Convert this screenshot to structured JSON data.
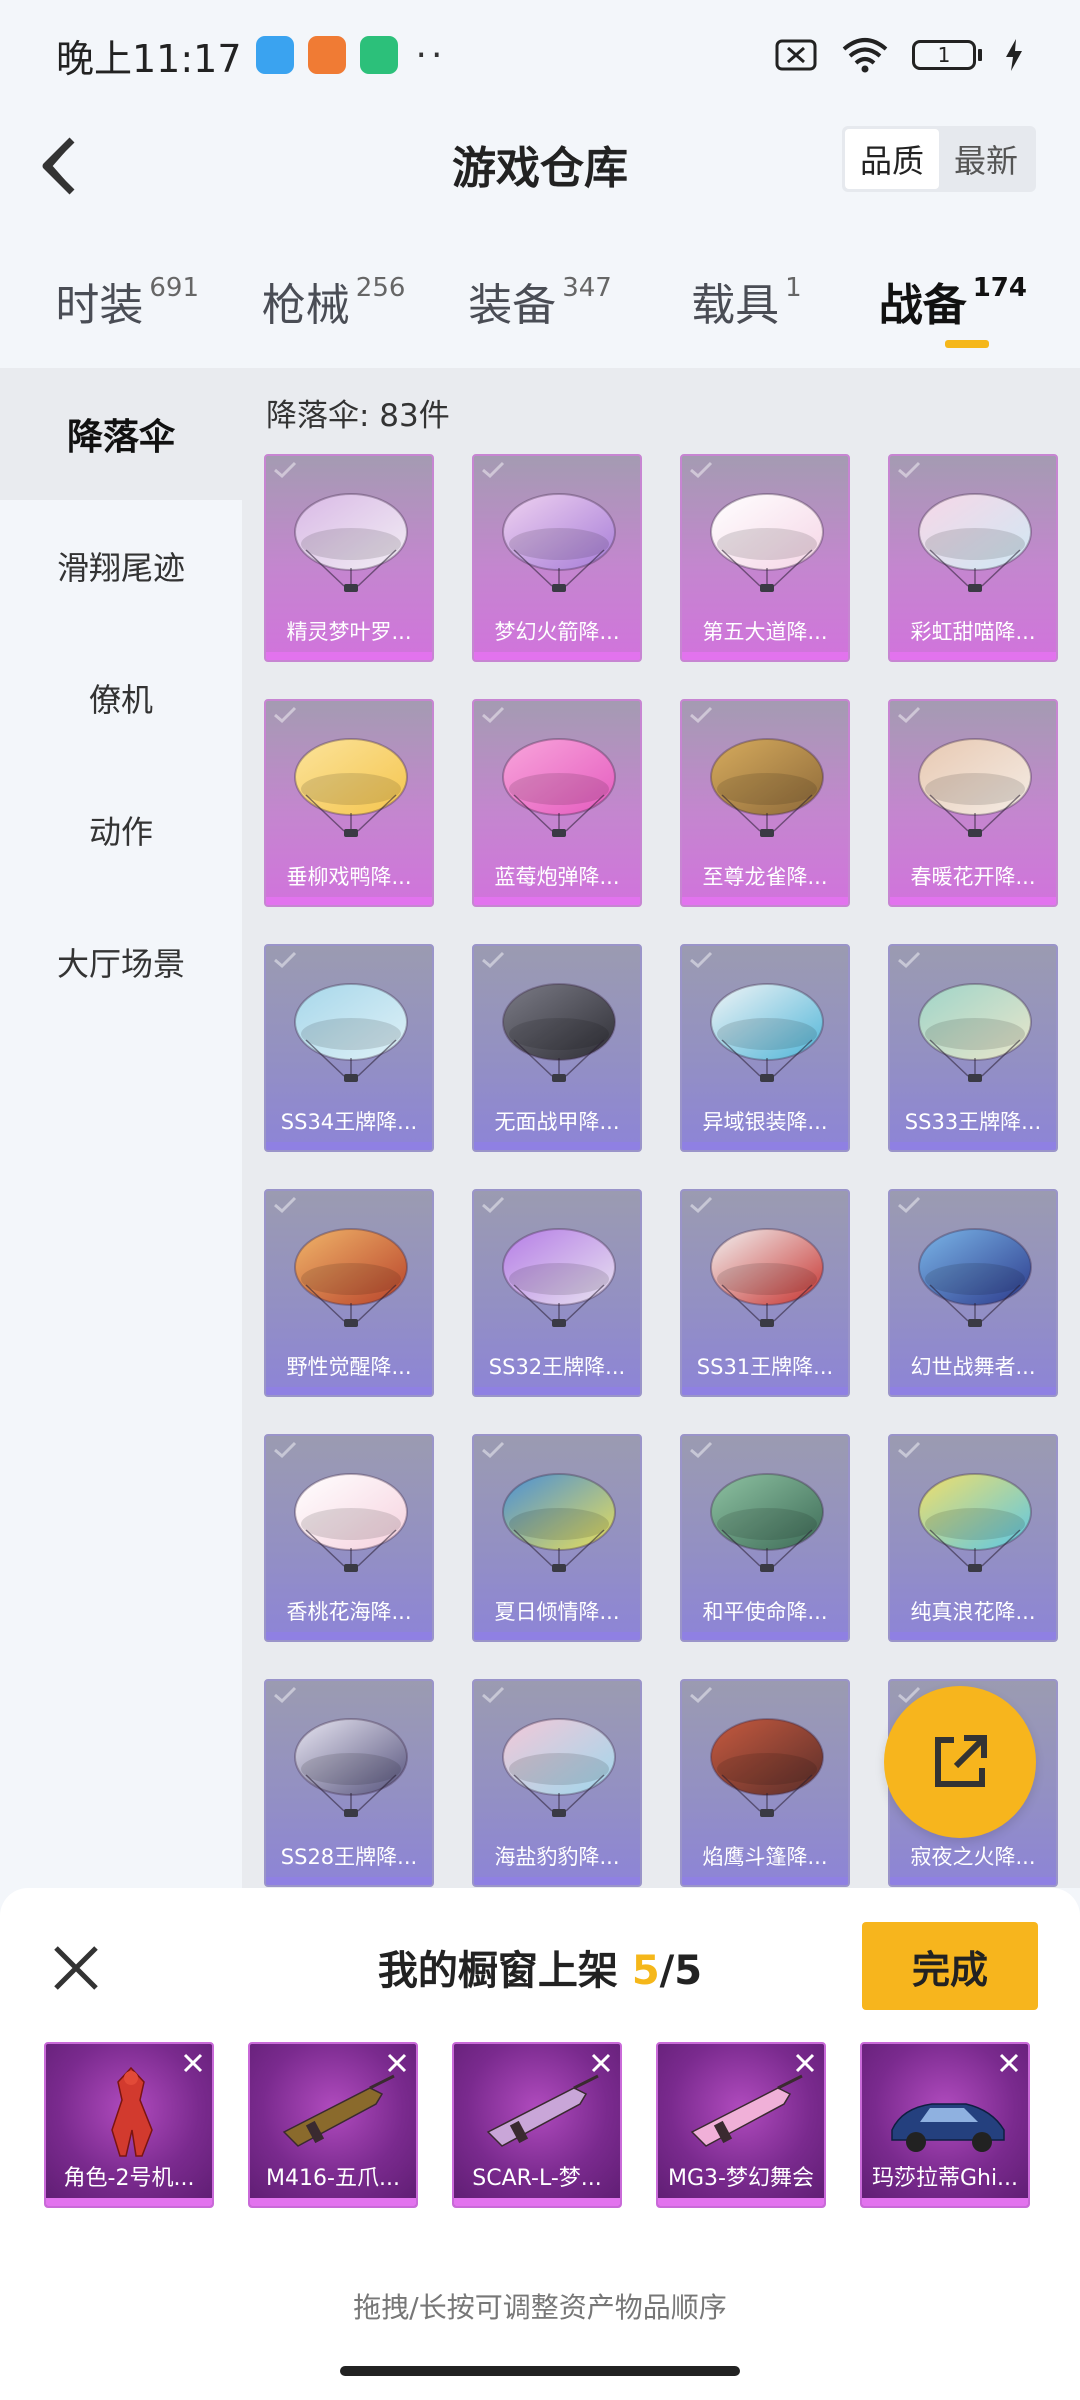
{
  "status_bar": {
    "time": "晚上11:17",
    "battery": "1"
  },
  "header": {
    "title": "游戏仓库",
    "sort_options": [
      "品质",
      "最新"
    ]
  },
  "tabs": [
    {
      "label": "时装",
      "count": "691"
    },
    {
      "label": "枪械",
      "count": "256"
    },
    {
      "label": "装备",
      "count": "347"
    },
    {
      "label": "载具",
      "count": "1"
    },
    {
      "label": "战备",
      "count": "174"
    }
  ],
  "sidebar": [
    "降落伞",
    "滑翔尾迹",
    "僚机",
    "动作",
    "大厅场景"
  ],
  "content": {
    "count_label": "降落伞: 83件",
    "items": [
      {
        "name": "精灵梦叶罗...",
        "tier": "pink",
        "colors": [
          "#f2eef4",
          "#d9b9e6"
        ]
      },
      {
        "name": "梦幻火箭降...",
        "tier": "pink",
        "colors": [
          "#a67cd8",
          "#efd2f0"
        ]
      },
      {
        "name": "第五大道降...",
        "tier": "pink",
        "colors": [
          "#f5d5e6",
          "#ffffff"
        ]
      },
      {
        "name": "彩虹甜喵降...",
        "tier": "pink",
        "colors": [
          "#cfe8f4",
          "#f7d7e7"
        ]
      },
      {
        "name": "垂柳戏鸭降...",
        "tier": "pink",
        "colors": [
          "#f5c54e",
          "#fbe39a"
        ]
      },
      {
        "name": "蓝莓炮弹降...",
        "tier": "pink",
        "colors": [
          "#e55bbf",
          "#f8a5db"
        ]
      },
      {
        "name": "至尊龙雀降...",
        "tier": "pink",
        "colors": [
          "#8e6a3a",
          "#d6ab5d"
        ]
      },
      {
        "name": "春暖花开降...",
        "tier": "pink",
        "colors": [
          "#f4ece5",
          "#e8c9b2"
        ]
      },
      {
        "name": "SS34王牌降...",
        "tier": "purple",
        "colors": [
          "#dff1f7",
          "#a7d7ea"
        ]
      },
      {
        "name": "无面战甲降...",
        "tier": "purple",
        "colors": [
          "#2f2f36",
          "#7b7b86"
        ]
      },
      {
        "name": "异域银装降...",
        "tier": "purple",
        "colors": [
          "#4fb5d8",
          "#f0f4f6"
        ]
      },
      {
        "name": "SS33王牌降...",
        "tier": "purple",
        "colors": [
          "#e9e6cb",
          "#9fd4c8"
        ]
      },
      {
        "name": "野性觉醒降...",
        "tier": "purple",
        "colors": [
          "#b8422a",
          "#f0b56a"
        ]
      },
      {
        "name": "SS32王牌降...",
        "tier": "purple",
        "colors": [
          "#e8e3f0",
          "#b57de6"
        ]
      },
      {
        "name": "SS31王牌降...",
        "tier": "purple",
        "colors": [
          "#c7332f",
          "#f2f2f2"
        ]
      },
      {
        "name": "幻世战舞者...",
        "tier": "purple",
        "colors": [
          "#2c3a8c",
          "#7bb6e8"
        ]
      },
      {
        "name": "香桃花海降...",
        "tier": "purple",
        "colors": [
          "#f6d1de",
          "#ffffff"
        ]
      },
      {
        "name": "夏日倾情降...",
        "tier": "purple",
        "colors": [
          "#e8df5a",
          "#4a8fd6"
        ]
      },
      {
        "name": "和平使命降...",
        "tier": "purple",
        "colors": [
          "#3d6b57",
          "#8ec2a2"
        ]
      },
      {
        "name": "纯真浪花降...",
        "tier": "purple",
        "colors": [
          "#5cc7e6",
          "#f1df6a"
        ]
      },
      {
        "name": "SS28王牌降...",
        "tier": "purple",
        "colors": [
          "#55527c",
          "#e8e6f2"
        ]
      },
      {
        "name": "海盐豹豹降...",
        "tier": "purple",
        "colors": [
          "#9fd7ec",
          "#f3c8d8"
        ]
      },
      {
        "name": "焰鹰斗篷降...",
        "tier": "purple",
        "colors": [
          "#5a2e2a",
          "#c65a3f"
        ]
      },
      {
        "name": "寂夜之火降...",
        "tier": "purple",
        "colors": [
          "#3a2a45",
          "#d15a3a"
        ]
      }
    ]
  },
  "showcase": {
    "title_prefix": "我的橱窗上架",
    "count": "5",
    "total": "/5",
    "done_label": "完成",
    "items": [
      "角色-2号机...",
      "M416-五爪...",
      "SCAR-L-梦...",
      "MG3-梦幻舞会",
      "玛莎拉蒂Ghi..."
    ],
    "hint": "拖拽/长按可调整资产物品顺序"
  },
  "colors": {
    "accent": "#f7b51d",
    "pink_tier": "#d173dc",
    "purple_tier": "#8d84d7"
  },
  "icons": {
    "back": "chevron-left-icon",
    "share": "external-link-icon",
    "close": "close-icon",
    "remove": "remove-x-icon"
  }
}
